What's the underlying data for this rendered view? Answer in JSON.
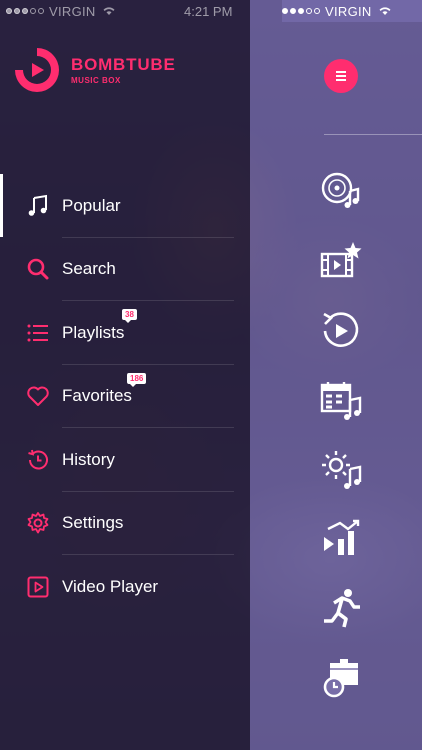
{
  "status_left": {
    "carrier": "VIRGIN",
    "time": "4:21 PM"
  },
  "status_right": {
    "carrier": "VIRGIN"
  },
  "brand": {
    "name": "BOMBTUBE",
    "tagline": "MUSIC BOX",
    "accent": "#ff2d6f"
  },
  "menu": {
    "items": [
      {
        "label": "Popular",
        "icon": "music-note-icon",
        "active": true
      },
      {
        "label": "Search",
        "icon": "search-icon"
      },
      {
        "label": "Playlists",
        "icon": "playlist-icon",
        "badge": "38"
      },
      {
        "label": "Favorites",
        "icon": "heart-icon",
        "badge": "186"
      },
      {
        "label": "History",
        "icon": "history-icon"
      },
      {
        "label": "Settings",
        "icon": "gear-icon"
      },
      {
        "label": "Video Player",
        "icon": "video-player-icon"
      }
    ]
  },
  "right_panel": {
    "icons": [
      "disc-music-icon",
      "film-star-icon",
      "replay-icon",
      "calendar-music-icon",
      "sun-music-icon",
      "chart-play-icon",
      "runner-icon",
      "box-timer-icon"
    ]
  }
}
